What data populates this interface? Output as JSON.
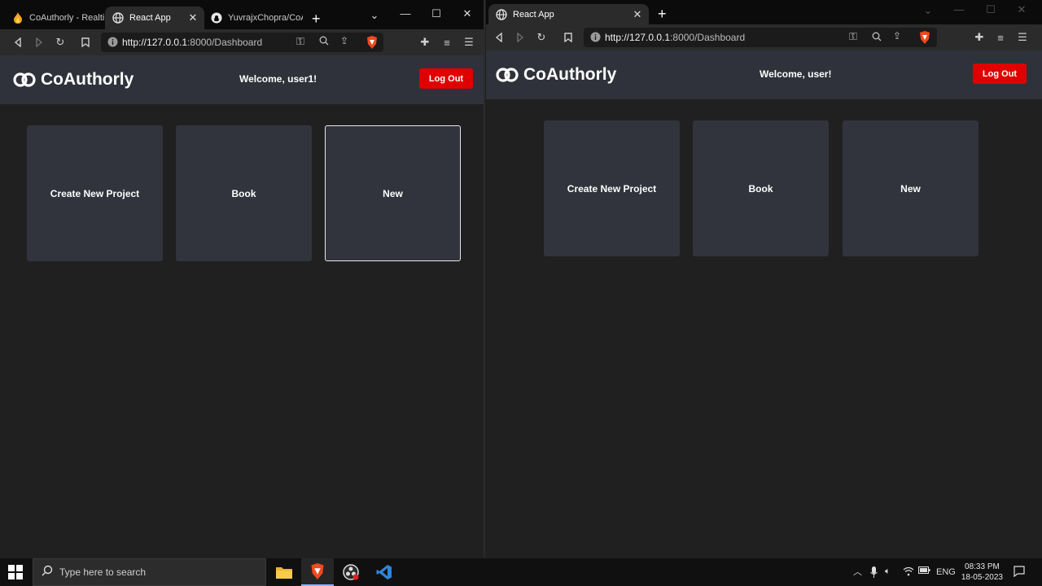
{
  "left_window": {
    "tabs": [
      {
        "title": "CoAuthorly - Realtim",
        "icon": "flame-icon"
      },
      {
        "title": "React App",
        "icon": "globe-icon"
      },
      {
        "title": "YuvrajxChopra/CoAu",
        "icon": "github-icon"
      }
    ],
    "url_host": "http://127.0.0.1",
    "url_path": ":8000/Dashboard",
    "app": {
      "brand": "CoAuthorly",
      "welcome": "Welcome, user1!",
      "logout": "Log Out",
      "cards": [
        "Create New Project",
        "Book",
        "New"
      ]
    }
  },
  "right_window": {
    "tabs": [
      {
        "title": "React App",
        "icon": "globe-icon"
      }
    ],
    "url_host": "http://127.0.0.1",
    "url_path": ":8000/Dashboard",
    "app": {
      "brand": "CoAuthorly",
      "welcome": "Welcome, user!",
      "logout": "Log Out",
      "cards": [
        "Create New Project",
        "Book",
        "New"
      ]
    }
  },
  "taskbar": {
    "search_placeholder": "Type here to search",
    "language": "ENG",
    "time": "08:33 PM",
    "date": "18-05-2023",
    "apps": [
      "file-explorer-icon",
      "brave-icon",
      "obs-icon",
      "vscode-icon"
    ]
  },
  "colors": {
    "navbar": "#2f323a",
    "card": "#31343d",
    "logout": "#e00000",
    "background": "#202020"
  }
}
